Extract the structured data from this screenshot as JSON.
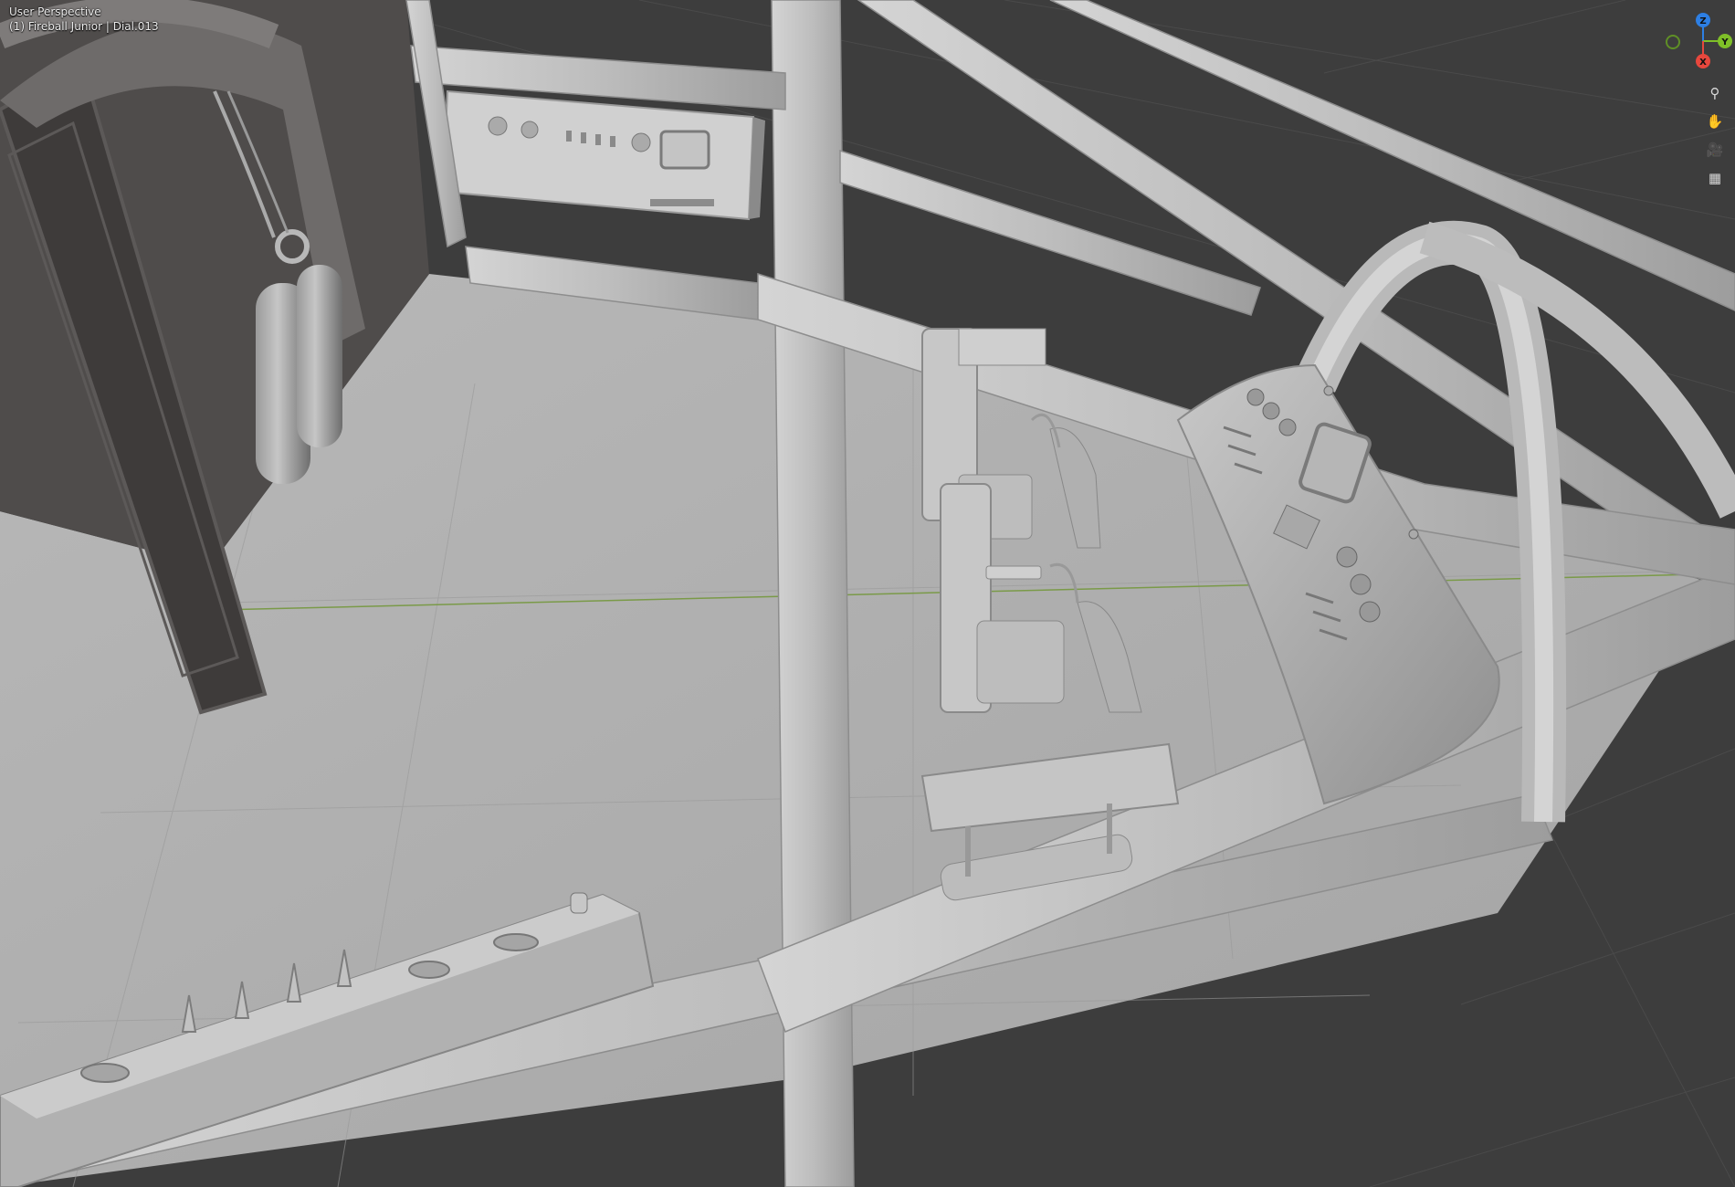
{
  "viewport": {
    "mode_label": "User Perspective",
    "object_label": "(1) Fireball Junior | Dial.013"
  },
  "gizmo": {
    "axes": [
      {
        "label": "Z",
        "color": "#2d7fe4"
      },
      {
        "label": "Y",
        "color": "#7fc028"
      },
      {
        "label": "X",
        "color": "#e8473d"
      }
    ],
    "neg_y_color": "#5f8f26"
  },
  "nav_tools": [
    {
      "icon": "zoom-icon",
      "glyph": "⚲"
    },
    {
      "icon": "hand-pan-icon",
      "glyph": "✋"
    },
    {
      "icon": "camera-icon",
      "glyph": "🎥"
    },
    {
      "icon": "grid-icon",
      "glyph": "▦"
    }
  ],
  "colors": {
    "background": "#3d3d3d",
    "grid_line": "#4a4a4a",
    "mesh_light": "#c9c9c9",
    "mesh_mid": "#a9a9a9",
    "mesh_dark": "#4f4c4b",
    "x_axis_line": "#7a9a48",
    "edge_highlight": "#cc2222"
  }
}
